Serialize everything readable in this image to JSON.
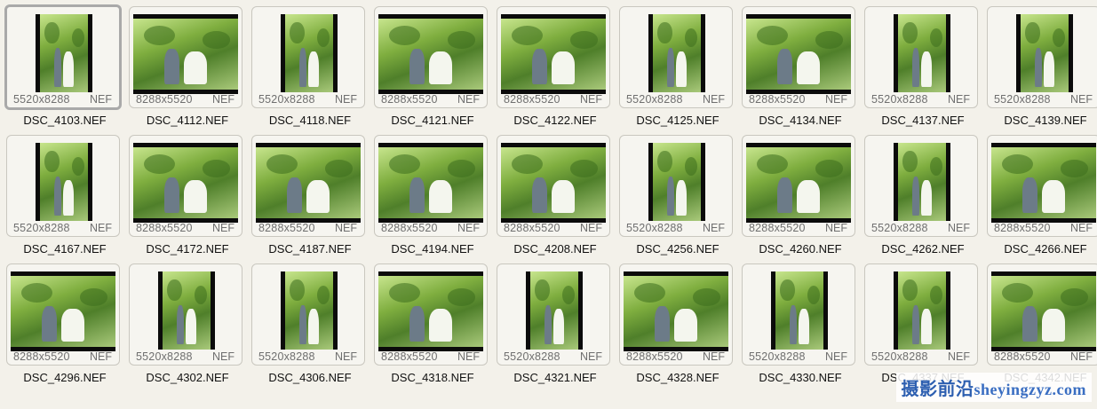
{
  "files": [
    {
      "name": "DSC_4103.NEF",
      "dims": "5520x8288",
      "ext": "NEF",
      "orientation": "portrait",
      "selected": true
    },
    {
      "name": "DSC_4112.NEF",
      "dims": "8288x5520",
      "ext": "NEF",
      "orientation": "landscape"
    },
    {
      "name": "DSC_4118.NEF",
      "dims": "5520x8288",
      "ext": "NEF",
      "orientation": "portrait"
    },
    {
      "name": "DSC_4121.NEF",
      "dims": "8288x5520",
      "ext": "NEF",
      "orientation": "landscape"
    },
    {
      "name": "DSC_4122.NEF",
      "dims": "8288x5520",
      "ext": "NEF",
      "orientation": "landscape"
    },
    {
      "name": "DSC_4125.NEF",
      "dims": "5520x8288",
      "ext": "NEF",
      "orientation": "portrait"
    },
    {
      "name": "DSC_4134.NEF",
      "dims": "8288x5520",
      "ext": "NEF",
      "orientation": "landscape"
    },
    {
      "name": "DSC_4137.NEF",
      "dims": "5520x8288",
      "ext": "NEF",
      "orientation": "portrait"
    },
    {
      "name": "DSC_4139.NEF",
      "dims": "5520x8288",
      "ext": "NEF",
      "orientation": "portrait"
    },
    {
      "name": "DSC_4167.NEF",
      "dims": "5520x8288",
      "ext": "NEF",
      "orientation": "portrait"
    },
    {
      "name": "DSC_4172.NEF",
      "dims": "8288x5520",
      "ext": "NEF",
      "orientation": "landscape"
    },
    {
      "name": "DSC_4187.NEF",
      "dims": "8288x5520",
      "ext": "NEF",
      "orientation": "landscape"
    },
    {
      "name": "DSC_4194.NEF",
      "dims": "8288x5520",
      "ext": "NEF",
      "orientation": "landscape"
    },
    {
      "name": "DSC_4208.NEF",
      "dims": "8288x5520",
      "ext": "NEF",
      "orientation": "landscape"
    },
    {
      "name": "DSC_4256.NEF",
      "dims": "5520x8288",
      "ext": "NEF",
      "orientation": "portrait"
    },
    {
      "name": "DSC_4260.NEF",
      "dims": "8288x5520",
      "ext": "NEF",
      "orientation": "landscape"
    },
    {
      "name": "DSC_4262.NEF",
      "dims": "5520x8288",
      "ext": "NEF",
      "orientation": "portrait"
    },
    {
      "name": "DSC_4266.NEF",
      "dims": "8288x5520",
      "ext": "NEF",
      "orientation": "landscape"
    },
    {
      "name": "DSC_4296.NEF",
      "dims": "8288x5520",
      "ext": "NEF",
      "orientation": "landscape"
    },
    {
      "name": "DSC_4302.NEF",
      "dims": "5520x8288",
      "ext": "NEF",
      "orientation": "portrait"
    },
    {
      "name": "DSC_4306.NEF",
      "dims": "5520x8288",
      "ext": "NEF",
      "orientation": "portrait"
    },
    {
      "name": "DSC_4318.NEF",
      "dims": "8288x5520",
      "ext": "NEF",
      "orientation": "landscape"
    },
    {
      "name": "DSC_4321.NEF",
      "dims": "5520x8288",
      "ext": "NEF",
      "orientation": "portrait"
    },
    {
      "name": "DSC_4328.NEF",
      "dims": "8288x5520",
      "ext": "NEF",
      "orientation": "landscape"
    },
    {
      "name": "DSC_4330.NEF",
      "dims": "5520x8288",
      "ext": "NEF",
      "orientation": "portrait"
    },
    {
      "name": "DSC_4337.NEF",
      "dims": "5520x8288",
      "ext": "NEF",
      "orientation": "portrait"
    },
    {
      "name": "DSC_4342.NEF",
      "dims": "8288x5520",
      "ext": "NEF",
      "orientation": "landscape"
    }
  ],
  "watermark": {
    "cjk": "摄影前沿",
    "latin": "sheyingzyz.com"
  }
}
